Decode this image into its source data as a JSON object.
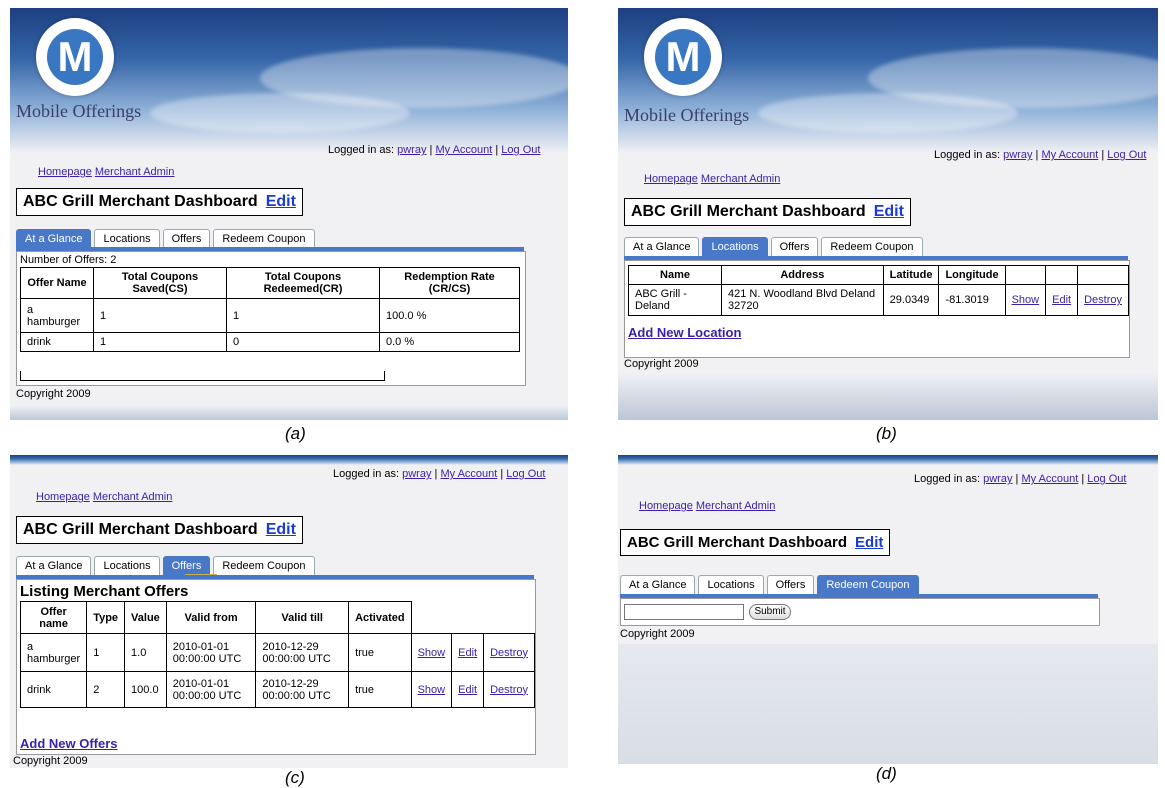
{
  "brand": "Mobile Offerings",
  "logo_letter": "M",
  "login": {
    "prefix": "Logged in as:",
    "user": "pwray",
    "sep1": "|",
    "account": "My Account",
    "sep2": "|",
    "logout": "Log Out"
  },
  "nav": {
    "home": "Homepage",
    "merchant_admin": "Merchant Admin"
  },
  "dashboard": {
    "title": "ABC Grill Merchant Dashboard",
    "edit": "Edit"
  },
  "tabs": [
    "At a Glance",
    "Locations",
    "Offers",
    "Redeem Coupon"
  ],
  "copyright": "Copyright 2009",
  "tooltip": "active",
  "captions": {
    "a": "(a)",
    "b": "(b)",
    "c": "(c)",
    "d": "(d)"
  },
  "glance": {
    "count_text": "Number of Offers: 2",
    "headers": [
      "Offer Name",
      "Total Coupons Saved(CS)",
      "Total Coupons Redeemed(CR)",
      "Redemption Rate (CR/CS)"
    ],
    "rows": [
      [
        "a hamburger",
        "1",
        "1",
        "100.0 %"
      ],
      [
        "drink",
        "1",
        "0",
        "0.0 %"
      ]
    ]
  },
  "locations": {
    "headers": [
      "Name",
      "Address",
      "Latitude",
      "Longitude"
    ],
    "rows": [
      [
        "ABC Grill - Deland",
        "421 N. Woodland Blvd Deland 32720",
        "29.0349",
        "-81.3019"
      ]
    ],
    "actions": [
      "Show",
      "Edit",
      "Destroy"
    ],
    "add_new": "Add New Location"
  },
  "offers": {
    "heading": "Listing Merchant Offers",
    "headers": [
      "Offer name",
      "Type",
      "Value",
      "Valid from",
      "Valid till",
      "Activated"
    ],
    "rows": [
      [
        "a hamburger",
        "1",
        "1.0",
        "2010-01-01 00:00:00 UTC",
        "2010-12-29 00:00:00 UTC",
        "true"
      ],
      [
        "drink",
        "2",
        "100.0",
        "2010-01-01 00:00:00 UTC",
        "2010-12-29 00:00:00 UTC",
        "true"
      ]
    ],
    "actions": [
      "Show",
      "Edit",
      "Destroy"
    ],
    "add_new": "Add New Offers"
  },
  "redeem": {
    "submit": "Submit",
    "value": ""
  }
}
